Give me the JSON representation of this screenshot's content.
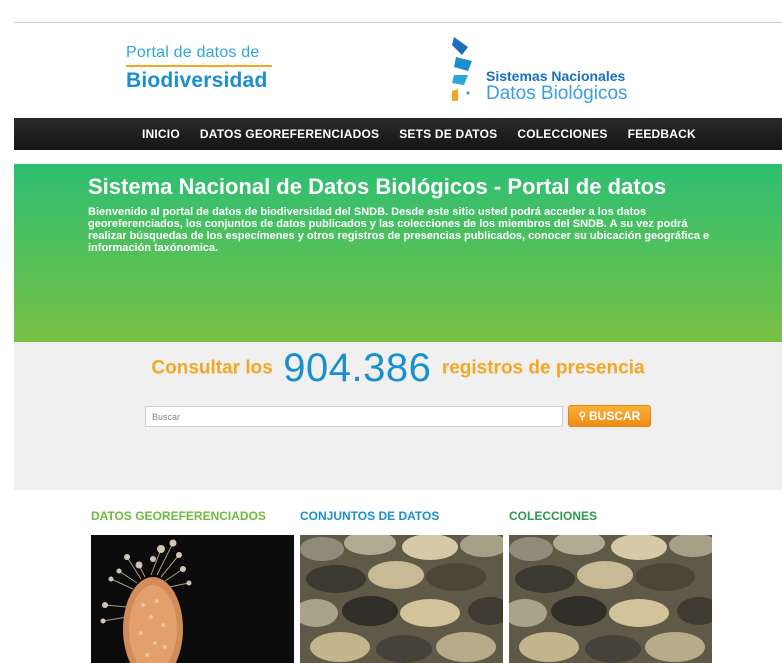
{
  "header": {
    "portal_line1": "Portal de datos de",
    "portal_line2": "Biodiversidad",
    "sndb_line1": "Sistemas Nacionales",
    "sndb_line2": "Datos Biológicos"
  },
  "nav": {
    "items": [
      {
        "label": "INICIO"
      },
      {
        "label": "DATOS GEOREFERENCIADOS"
      },
      {
        "label": "SETS DE DATOS"
      },
      {
        "label": "COLECCIONES"
      },
      {
        "label": "FEEDBACK"
      }
    ]
  },
  "hero": {
    "title": "Sistema Nacional de Datos Biológicos - Portal de datos",
    "text": "Bienvenido al portal de datos de biodiversidad del SNDB. Desde este sitio usted podrá acceder a los datos georeferenciados, los conjuntos de datos publicados y las colecciones de los miembros del SNDB. A su vez podrá realizar búsquedas de los especímenes y otros registros de presencias publicados, conocer su ubicación geográfica e información taxónomica."
  },
  "search": {
    "prefix": "Consultar los",
    "count": "904.386",
    "suffix": "registros de presencia",
    "placeholder": "Buscar",
    "button_label": "BUSCAR"
  },
  "sections": [
    {
      "title": "DATOS GEOREFERENCIADOS"
    },
    {
      "title": "CONJUNTOS DE DATOS"
    },
    {
      "title": "COLECCIONES"
    }
  ],
  "colors": {
    "accent_orange": "#f5a623",
    "accent_blue": "#1a8fd0",
    "hero_green_top": "#2dbf72",
    "hero_green_bottom": "#79c044"
  }
}
